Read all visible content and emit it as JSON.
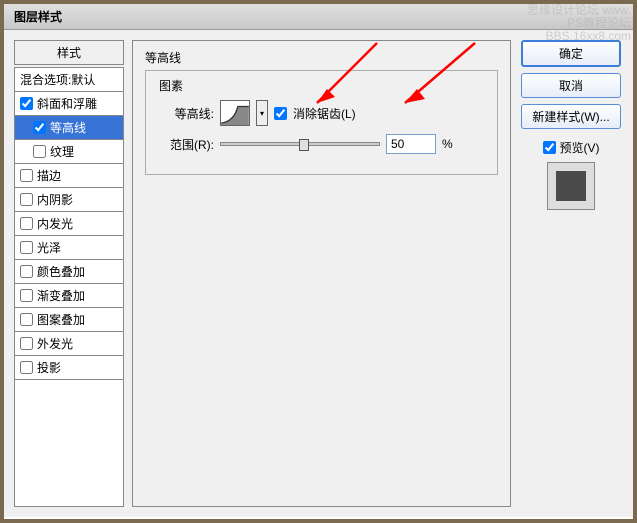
{
  "title": "图层样式",
  "styles_header": "样式",
  "blend_options": "混合选项:默认",
  "style_items": [
    {
      "label": "斜面和浮雕",
      "checked": true,
      "selected": false,
      "indent": false
    },
    {
      "label": "等高线",
      "checked": true,
      "selected": true,
      "indent": true
    },
    {
      "label": "纹理",
      "checked": false,
      "selected": false,
      "indent": true
    },
    {
      "label": "描边",
      "checked": false,
      "selected": false,
      "indent": false
    },
    {
      "label": "内阴影",
      "checked": false,
      "selected": false,
      "indent": false
    },
    {
      "label": "内发光",
      "checked": false,
      "selected": false,
      "indent": false
    },
    {
      "label": "光泽",
      "checked": false,
      "selected": false,
      "indent": false
    },
    {
      "label": "颜色叠加",
      "checked": false,
      "selected": false,
      "indent": false
    },
    {
      "label": "渐变叠加",
      "checked": false,
      "selected": false,
      "indent": false
    },
    {
      "label": "图案叠加",
      "checked": false,
      "selected": false,
      "indent": false
    },
    {
      "label": "外发光",
      "checked": false,
      "selected": false,
      "indent": false
    },
    {
      "label": "投影",
      "checked": false,
      "selected": false,
      "indent": false
    }
  ],
  "panel": {
    "title": "等高线",
    "group": "图素",
    "contour_label": "等高线:",
    "antialias_label": "消除锯齿(L)",
    "antialias_checked": true,
    "range_label": "范围(R):",
    "range_value": "50",
    "range_unit": "%"
  },
  "buttons": {
    "ok": "确定",
    "cancel": "取消",
    "new_style": "新建样式(W)...",
    "preview": "预览(V)",
    "preview_checked": true
  },
  "watermark": {
    "l1": "思缘设计论坛  www.",
    "l2": "PS教程论坛",
    "l3": "BBS.16xx8.com"
  }
}
